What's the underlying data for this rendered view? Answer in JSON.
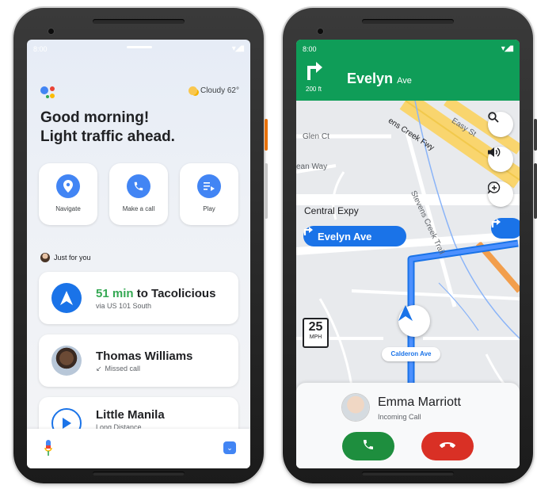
{
  "left_phone": {
    "status": {
      "time": "8:00",
      "signal": "▾◢▮"
    },
    "assistant": {
      "weather": "Cloudy 62°",
      "greeting_line1": "Good morning!",
      "greeting_line2": "Light traffic ahead.",
      "tiles": [
        {
          "label": "Navigate",
          "icon": "location-pin-icon"
        },
        {
          "label": "Make a call",
          "icon": "phone-icon"
        },
        {
          "label": "Play",
          "icon": "playlist-icon"
        }
      ],
      "section_label": "Just for you",
      "cards": [
        {
          "title_prefix": "51 min",
          "title_suffix": " to Tacolicious",
          "subtitle": "via US 101 South",
          "icon": "navigation-arrow-icon"
        },
        {
          "title": "Thomas Williams",
          "subtitle": "Missed call",
          "icon": "missed-call-icon"
        },
        {
          "title": "Little Manila",
          "subtitle": "Long Distance",
          "icon": "play-icon"
        }
      ]
    },
    "colors": {
      "google_blue": "#4285f4",
      "green": "#34a853"
    }
  },
  "right_phone": {
    "status": {
      "time": "8:00",
      "signal": "▾◢▮"
    },
    "navigation": {
      "distance": "200 ft",
      "street_name": "Evelyn",
      "street_suffix": "Ave",
      "turn_icon": "turn-right-icon"
    },
    "map": {
      "labels": [
        "Glen Ct",
        "ean Way",
        "Central Expy",
        "ens Creek Fwy",
        "Easy St",
        "Stevens Creek Trail"
      ],
      "turn_pill": "Evelyn Ave",
      "current_road": "Calderon Ave",
      "speed_limit": "25",
      "speed_unit": "MPH",
      "buttons": [
        "search-icon",
        "volume-icon",
        "add-report-icon"
      ]
    },
    "call": {
      "name": "Emma Marriott",
      "status": "Incoming Call"
    },
    "colors": {
      "header_green": "#0f9d58",
      "route_blue": "#1a73e8",
      "accept": "#1e8e3e",
      "decline": "#d93025"
    }
  }
}
